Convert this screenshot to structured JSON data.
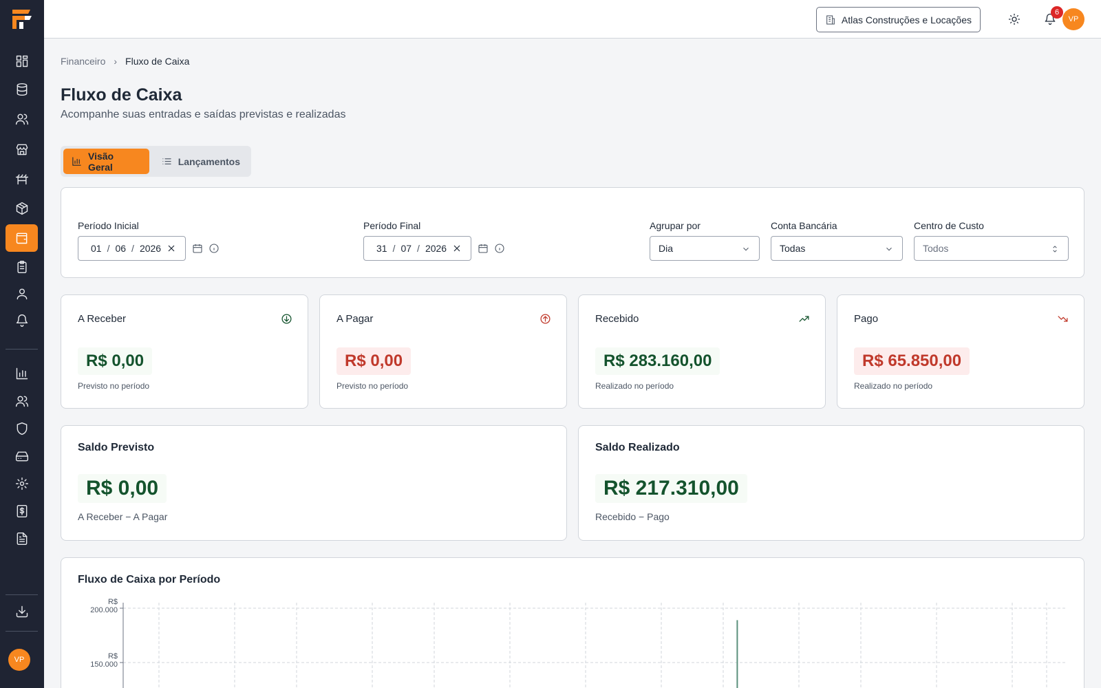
{
  "sidebar": {
    "logo": "app-logo",
    "items": [
      {
        "icon": "dashboard-icon"
      },
      {
        "icon": "database-icon"
      },
      {
        "icon": "users-icon"
      },
      {
        "icon": "store-icon"
      },
      {
        "icon": "machinery-icon"
      },
      {
        "icon": "package-icon"
      },
      {
        "icon": "wallet-icon",
        "active": true
      },
      {
        "icon": "clipboard-icon"
      },
      {
        "icon": "user-icon"
      },
      {
        "icon": "bell-icon"
      },
      {
        "icon": "bar-chart-icon"
      },
      {
        "icon": "team-icon"
      },
      {
        "icon": "shield-icon"
      },
      {
        "icon": "hard-drive-icon"
      },
      {
        "icon": "settings-icon"
      },
      {
        "icon": "invoice-icon"
      },
      {
        "icon": "document-icon"
      }
    ],
    "download_icon": "download-icon",
    "avatar": "VP"
  },
  "topbar": {
    "company": "Atlas Construções e Locações",
    "notifications_count": "6",
    "avatar": "VP"
  },
  "breadcrumb": {
    "parent": "Financeiro",
    "current": "Fluxo de Caixa"
  },
  "page": {
    "title": "Fluxo de Caixa",
    "subtitle": "Acompanhe suas entradas e saídas previstas e realizadas"
  },
  "tabs": [
    {
      "label": "Visão Geral",
      "active": true
    },
    {
      "label": "Lançamentos",
      "active": false
    }
  ],
  "filters": {
    "start": {
      "label": "Período Inicial",
      "day": "01",
      "month": "06",
      "year": "2026"
    },
    "end": {
      "label": "Período Final",
      "day": "31",
      "month": "07",
      "year": "2026"
    },
    "group_by": {
      "label": "Agrupar por",
      "value": "Dia"
    },
    "bank_account": {
      "label": "Conta Bancária",
      "value": "Todas"
    },
    "cost_center": {
      "label": "Centro de Custo",
      "value": "Todos"
    }
  },
  "stats": [
    {
      "title": "A Receber",
      "value": "R$ 0,00",
      "note": "Previsto no período",
      "tone": "green",
      "icon": "arrow-down-circle-icon"
    },
    {
      "title": "A Pagar",
      "value": "R$ 0,00",
      "note": "Previsto no período",
      "tone": "red",
      "icon": "arrow-up-circle-icon"
    },
    {
      "title": "Recebido",
      "value": "R$ 283.160,00",
      "note": "Realizado no período",
      "tone": "green",
      "icon": "trending-up-icon"
    },
    {
      "title": "Pago",
      "value": "R$ 65.850,00",
      "note": "Realizado no período",
      "tone": "red",
      "icon": "trending-down-icon"
    }
  ],
  "balances": [
    {
      "title": "Saldo Previsto",
      "value": "R$ 0,00",
      "note": "A Receber − A Pagar"
    },
    {
      "title": "Saldo Realizado",
      "value": "R$ 217.310,00",
      "note": "Recebido − Pago"
    }
  ],
  "colors": {
    "accent": "#f7871f",
    "sidebar": "#1f2433",
    "positive": "#14532d",
    "negative": "#c0392b"
  },
  "chart_data": {
    "type": "bar",
    "title": "Fluxo de Caixa por Período",
    "y_ticks": [
      {
        "value": 200000,
        "label_line1": "R$",
        "label_line2": "200.000"
      },
      {
        "value": 150000,
        "label_line1": "R$",
        "label_line2": "150.000"
      }
    ],
    "bars": [
      {
        "x_index": 17,
        "value": 189000,
        "color": "#5a8f7b"
      }
    ],
    "ylim": [
      120000,
      210000
    ],
    "grid": true
  }
}
